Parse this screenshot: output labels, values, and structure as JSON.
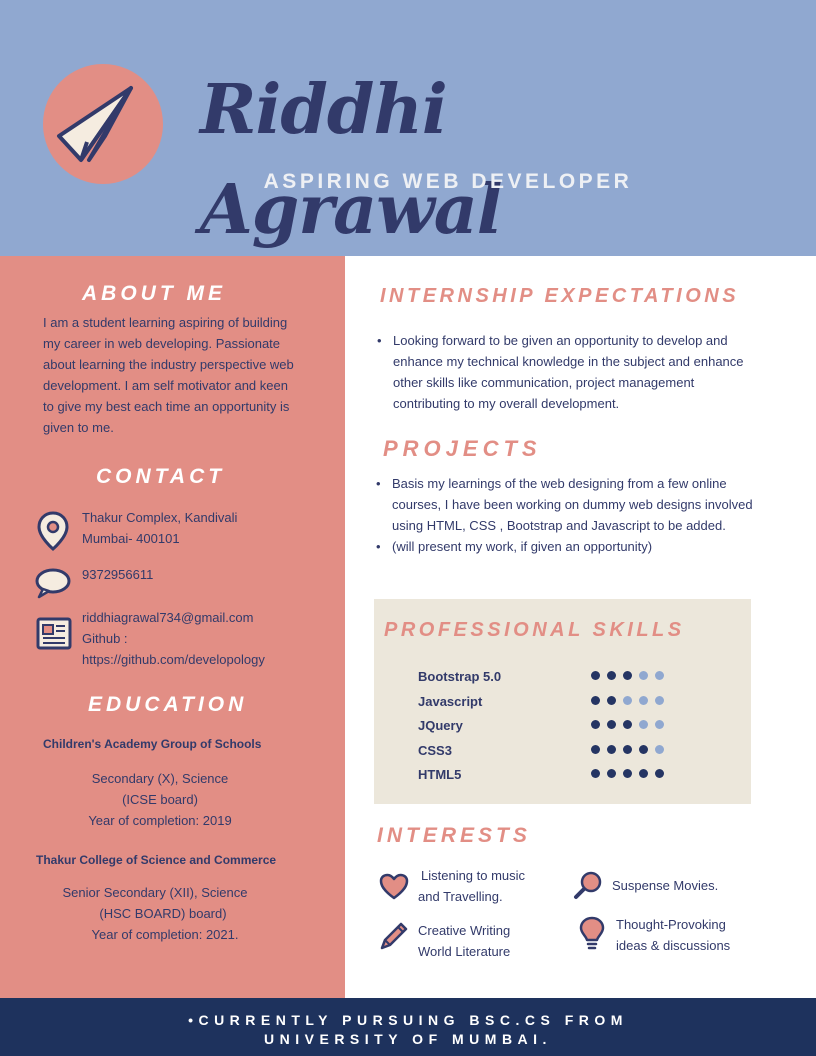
{
  "header": {
    "name": "Riddhi Agrawal",
    "subtitle": "ASPIRING WEB DEVELOPER"
  },
  "about": {
    "title": "ABOUT ME",
    "text": "I am a student learning aspiring of building my career in web developing. Passionate about learning the industry perspective web development. I am self motivator and keen to give my best each time an opportunity is given to me."
  },
  "contact": {
    "title": "CONTACT",
    "address_line1": "Thakur Complex, Kandivali",
    "address_line2": "Mumbai- 400101",
    "phone": "9372956611",
    "email": "riddhiagrawal734@gmail.com",
    "github_label": "Github :",
    "github_url": "https://github.com/developology"
  },
  "education": {
    "title": "EDUCATION",
    "entries": [
      {
        "school": "Children's Academy Group of Schools",
        "line1": "Secondary (X), Science",
        "line2": "(ICSE board)",
        "line3": "Year of completion: 2019"
      },
      {
        "school": "Thakur College of Science and Commerce",
        "line1": "Senior Secondary (XII), Science",
        "line2": "(HSC BOARD) board)",
        "line3": "Year of completion: 2021."
      }
    ]
  },
  "internship": {
    "title": "INTERNSHIP EXPECTATIONS",
    "items": [
      "Looking forward to be given an opportunity to develop and enhance my technical knowledge in the subject and enhance other skills like communication, project management contributing to my overall development."
    ]
  },
  "projects": {
    "title": "PROJECTS",
    "items": [
      "Basis my learnings of the web designing from a few online courses, I have been working on dummy web designs involved using HTML, CSS , Bootstrap and Javascript to be added.",
      " (will present my work, if given an opportunity)"
    ]
  },
  "skills": {
    "title": "PROFESSIONAL SKILLS",
    "items": [
      {
        "name": "Bootstrap 5.0",
        "level": 3,
        "out_of": 5
      },
      {
        "name": "Javascript",
        "level": 2,
        "out_of": 5
      },
      {
        "name": "JQuery",
        "level": 3,
        "out_of": 5
      },
      {
        "name": "CSS3",
        "level": 4,
        "out_of": 5
      },
      {
        "name": "HTML5",
        "level": 5,
        "out_of": 5
      }
    ],
    "filled_color": "#253563",
    "empty_color": "#90a8d0"
  },
  "interests": {
    "title": "INTERESTS",
    "items": [
      {
        "icon": "heart-icon",
        "line1": "Listening to music",
        "line2": "and Travelling."
      },
      {
        "icon": "magnifier-icon",
        "line1": "Suspense Movies.",
        "line2": ""
      },
      {
        "icon": "pencil-icon",
        "line1": "Creative Writing",
        "line2": "World Literature"
      },
      {
        "icon": "lightbulb-icon",
        "line1": "Thought-Provoking",
        "line2": "ideas & discussions"
      }
    ]
  },
  "footer": {
    "line1": "•CURRENTLY PURSUING BSC.CS FROM",
    "line2": "UNIVERSITY OF MUMBAI."
  },
  "colors": {
    "header_bg": "#90a8d0",
    "left_bg": "#e28e85",
    "navy": "#323a6a",
    "footer_bg": "#1e325d",
    "skills_bg": "#ece7db"
  }
}
